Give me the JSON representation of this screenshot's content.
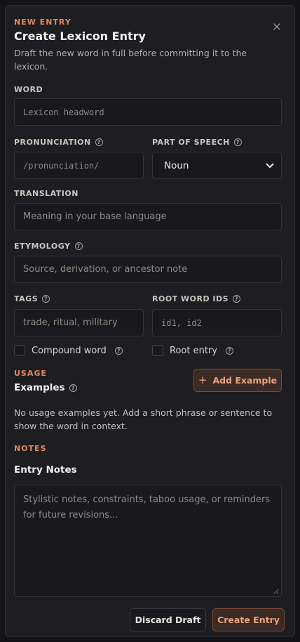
{
  "header": {
    "eyebrow": "NEW ENTRY",
    "title": "Create Lexicon Entry",
    "description": "Draft the new word in full before committing it to the lexicon."
  },
  "fields": {
    "word": {
      "label": "WORD",
      "placeholder": "Lexicon headword"
    },
    "pronunciation": {
      "label": "PRONUNCIATION",
      "placeholder": "/pronunciation/"
    },
    "part_of_speech": {
      "label": "PART OF SPEECH",
      "value": "Noun"
    },
    "translation": {
      "label": "TRANSLATION",
      "placeholder": "Meaning in your base language"
    },
    "etymology": {
      "label": "ETYMOLOGY",
      "placeholder": "Source, derivation, or ancestor note"
    },
    "tags": {
      "label": "TAGS",
      "placeholder": "trade, ritual, military"
    },
    "root_word_ids": {
      "label": "ROOT WORD IDS",
      "placeholder": "id1, id2"
    }
  },
  "checkboxes": {
    "compound": {
      "label": "Compound word",
      "checked": false
    },
    "root": {
      "label": "Root entry",
      "checked": false
    }
  },
  "usage": {
    "eyebrow": "USAGE",
    "heading": "Examples",
    "add_button": "Add Example",
    "empty_text": "No usage examples yet. Add a short phrase or sentence to show the word in context."
  },
  "notes": {
    "eyebrow": "NOTES",
    "heading": "Entry Notes",
    "placeholder": "Stylistic notes, constraints, taboo usage, or reminders for future revisions..."
  },
  "actions": {
    "discard": "Discard Draft",
    "create": "Create Entry"
  },
  "icons": {
    "close": "close-icon",
    "help": "help-circle-icon",
    "plus": "plus-icon",
    "chevron": "chevron-down-icon"
  },
  "colors": {
    "accent": "#e0875f",
    "background": "#1e1d21"
  }
}
